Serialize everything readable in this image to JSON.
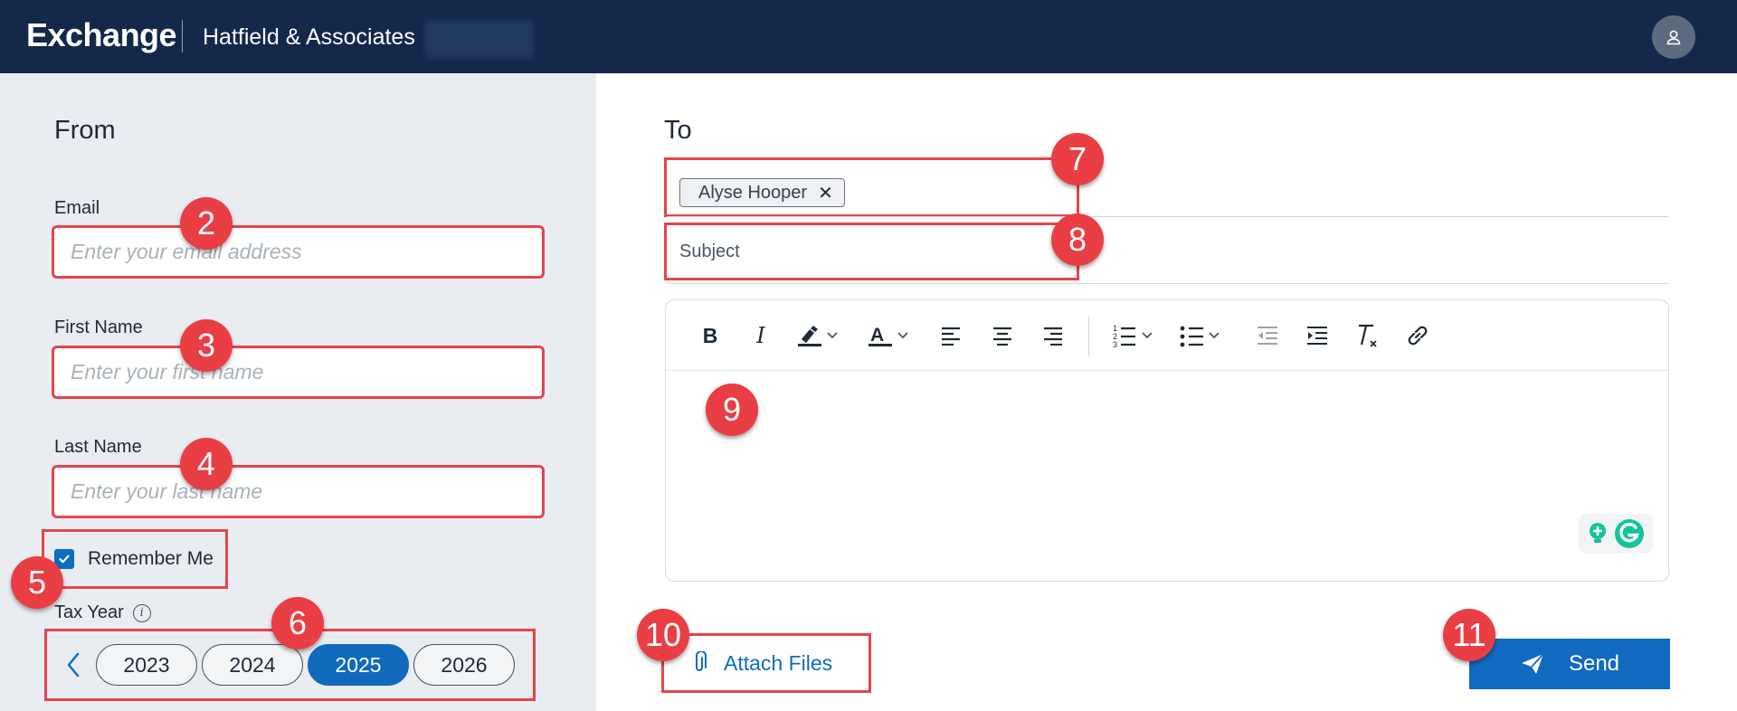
{
  "header": {
    "brand": "Exchange",
    "firm_name": "Hatfield & Associates"
  },
  "from_panel": {
    "title": "From",
    "email": {
      "label": "Email",
      "placeholder": "Enter your email address",
      "value": ""
    },
    "first_name": {
      "label": "First Name",
      "placeholder": "Enter your first name",
      "value": ""
    },
    "last_name": {
      "label": "Last Name",
      "placeholder": "Enter your last name",
      "value": ""
    },
    "remember_me": {
      "label": "Remember Me",
      "checked": true
    },
    "tax_year": {
      "label": "Tax Year",
      "info_icon": "info-icon",
      "years": [
        "2023",
        "2024",
        "2025",
        "2026"
      ],
      "selected": "2025"
    }
  },
  "to_panel": {
    "title": "To",
    "recipients": [
      "Alyse Hooper"
    ],
    "subject": {
      "placeholder": "Subject",
      "value": ""
    },
    "toolbar": [
      "bold-icon",
      "italic-icon",
      "highlight-icon",
      "font-color-icon",
      "align-left-icon",
      "align-center-icon",
      "align-right-icon",
      "numbered-list-icon",
      "bulleted-list-icon",
      "outdent-icon",
      "indent-icon",
      "clear-format-icon",
      "link-icon"
    ],
    "attach_label": "Attach Files",
    "send_label": "Send"
  },
  "annotations": [
    "2",
    "3",
    "4",
    "5",
    "6",
    "7",
    "8",
    "9",
    "10",
    "11"
  ],
  "colors": {
    "header_bg": "#13284b",
    "left_panel_bg": "#e9edf1",
    "accent": "#116abf",
    "annotation": "#ea3e45"
  }
}
